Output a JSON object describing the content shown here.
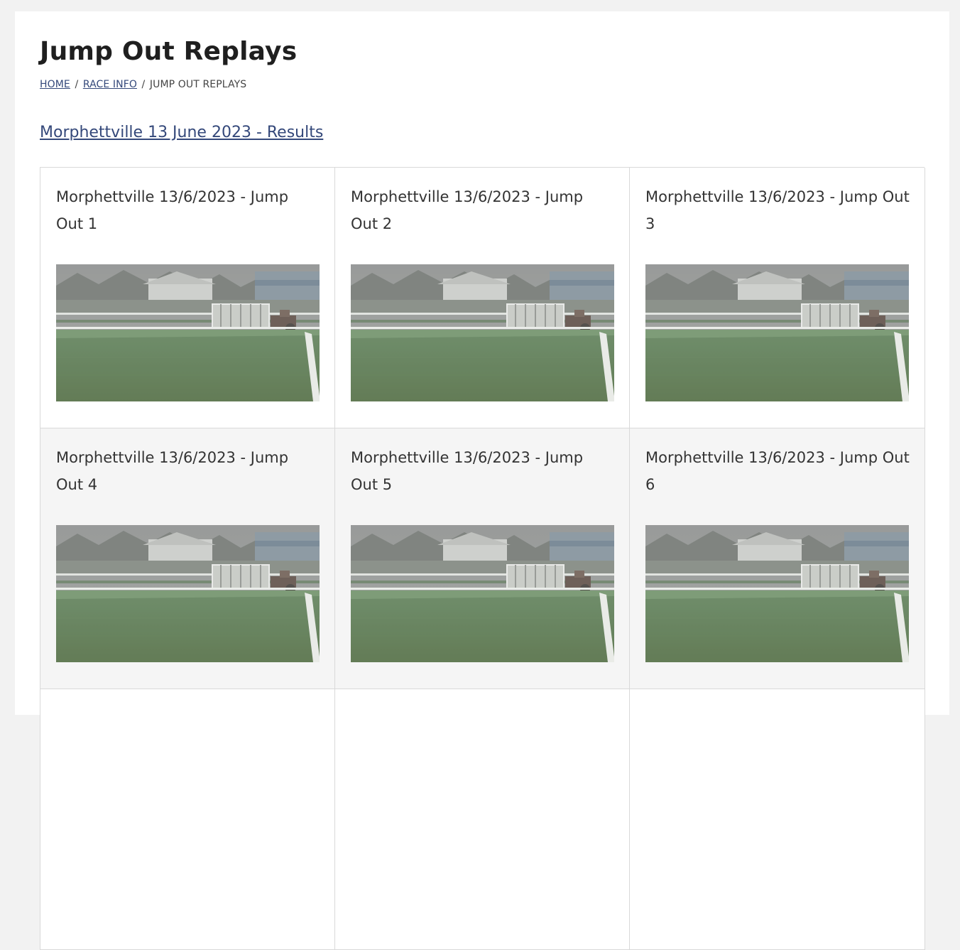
{
  "header": {
    "title": "Jump Out Replays"
  },
  "breadcrumb": {
    "items": [
      {
        "label": "HOME",
        "link": true
      },
      {
        "label": "RACE INFO",
        "link": true
      },
      {
        "label": "JUMP OUT REPLAYS",
        "link": false
      }
    ],
    "separator": "/"
  },
  "results_link": "Morphettville 13 June 2023 - Results",
  "replays": [
    {
      "title": "Morphettville 13/6/2023 - Jump Out 1",
      "thumbnail_icon": "racetrack-image"
    },
    {
      "title": "Morphettville 13/6/2023 - Jump Out 2",
      "thumbnail_icon": "racetrack-image"
    },
    {
      "title": "Morphettville 13/6/2023 - Jump Out 3",
      "thumbnail_icon": "racetrack-image"
    },
    {
      "title": "Morphettville 13/6/2023 - Jump Out 4",
      "thumbnail_icon": "racetrack-image"
    },
    {
      "title": "Morphettville 13/6/2023 - Jump Out 5",
      "thumbnail_icon": "racetrack-image"
    },
    {
      "title": "Morphettville 13/6/2023 - Jump Out 6",
      "thumbnail_icon": "racetrack-image"
    },
    {
      "title": "",
      "thumbnail_icon": ""
    },
    {
      "title": "",
      "thumbnail_icon": ""
    },
    {
      "title": "",
      "thumbnail_icon": ""
    }
  ],
  "colors": {
    "link": "#34487a",
    "border": "#d9d9d9",
    "alt_row_bg": "#f5f5f5"
  }
}
